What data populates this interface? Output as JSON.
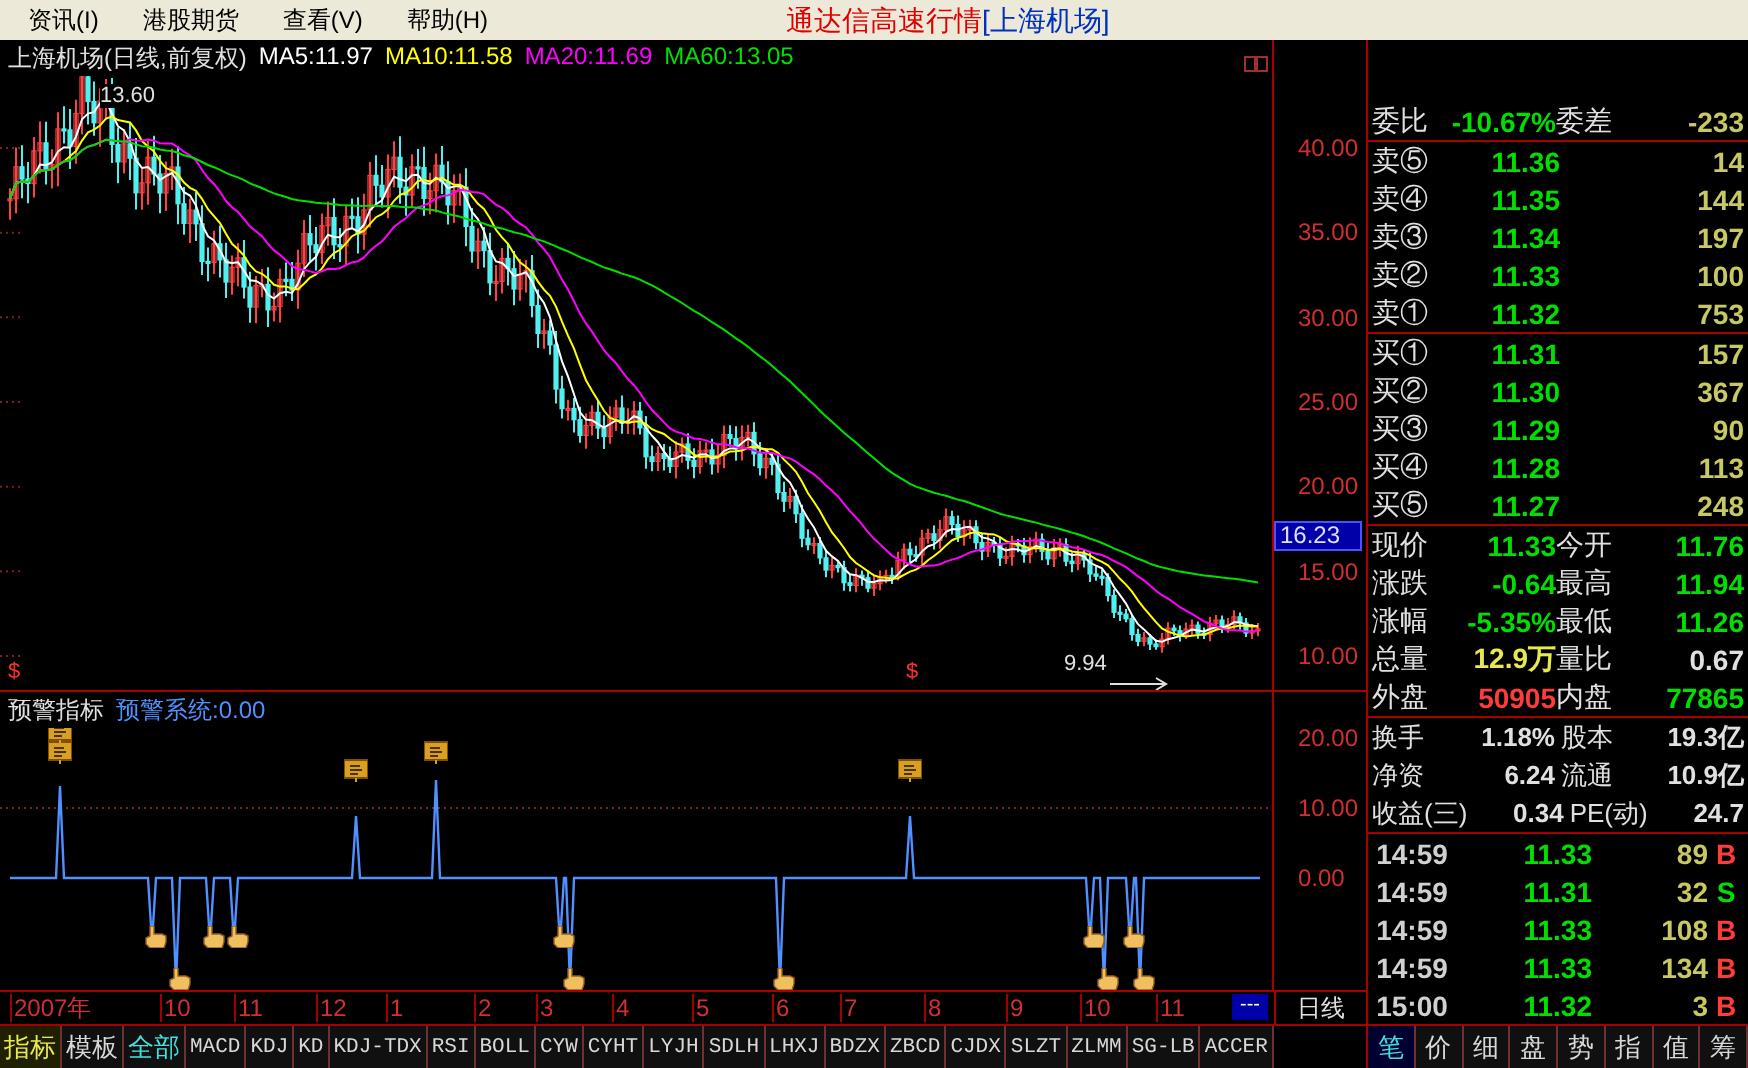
{
  "menu": [
    {
      "label": "资讯(I)"
    },
    {
      "label": "港股期货"
    },
    {
      "label": "查看(V)"
    },
    {
      "label": "帮助(H)"
    }
  ],
  "app_title": {
    "name": "通达信高速行情",
    "security": "[上海机场]"
  },
  "chart": {
    "title": "上海机场(日线,前复权)",
    "ma": [
      {
        "label": "MA5:11.97",
        "color": "#ffffff"
      },
      {
        "label": "MA10:11.58",
        "color": "#ffff00"
      },
      {
        "label": "MA20:11.69",
        "color": "#ff00ff"
      },
      {
        "label": "MA60:13.05",
        "color": "#00e000"
      }
    ],
    "high_label": "13.60",
    "low_label": "9.94",
    "signal_marks": [
      "$",
      "$"
    ],
    "price_ticks": [
      "40.00",
      "35.00",
      "30.00",
      "25.00",
      "20.00",
      "15.00",
      "10.00"
    ],
    "cursor_price": "16.23"
  },
  "indicator": {
    "name": "预警指标",
    "value_label": "预警系统:0.00",
    "ticks": [
      "20.00",
      "10.00",
      "0.00"
    ]
  },
  "date_axis": {
    "labels": [
      "2007年",
      "10",
      "11",
      "12",
      "1",
      "2",
      "3",
      "4",
      "5",
      "6",
      "7",
      "8",
      "9",
      "10",
      "11"
    ],
    "scroll_marker": "---",
    "period": "日线"
  },
  "indicator_tabs": [
    {
      "label": "指标",
      "kind": "label",
      "selected": false
    },
    {
      "label": "模板",
      "kind": "button",
      "selected": false
    },
    {
      "label": "全部",
      "kind": "button",
      "selected": true
    },
    {
      "label": "MACD",
      "kind": "button",
      "selected": false
    },
    {
      "label": "KDJ",
      "kind": "button",
      "selected": false
    },
    {
      "label": "KD",
      "kind": "button",
      "selected": false
    },
    {
      "label": "KDJ-TDX",
      "kind": "button",
      "selected": false
    },
    {
      "label": "RSI",
      "kind": "button",
      "selected": false
    },
    {
      "label": "BOLL",
      "kind": "button",
      "selected": false
    },
    {
      "label": "CYW",
      "kind": "button",
      "selected": false
    },
    {
      "label": "CYHT",
      "kind": "button",
      "selected": false
    },
    {
      "label": "LYJH",
      "kind": "button",
      "selected": false
    },
    {
      "label": "SDLH",
      "kind": "button",
      "selected": false
    },
    {
      "label": "LHXJ",
      "kind": "button",
      "selected": false
    },
    {
      "label": "BDZX",
      "kind": "button",
      "selected": false
    },
    {
      "label": "ZBCD",
      "kind": "button",
      "selected": false
    },
    {
      "label": "CJDX",
      "kind": "button",
      "selected": false
    },
    {
      "label": "SLZT",
      "kind": "button",
      "selected": false
    },
    {
      "label": "ZLMM",
      "kind": "button",
      "selected": false
    },
    {
      "label": "SG-LB",
      "kind": "button",
      "selected": false
    },
    {
      "label": "ACCER",
      "kind": "button",
      "selected": false
    }
  ],
  "quote": {
    "ratio": [
      {
        "label": "委比",
        "value": "-10.67%",
        "color": "#00e000"
      },
      {
        "label": "委差",
        "value": "-233",
        "color": "#c8c864"
      }
    ],
    "asks": [
      {
        "label": "卖⑤",
        "price": "11.36",
        "volume": "14"
      },
      {
        "label": "卖④",
        "price": "11.35",
        "volume": "144"
      },
      {
        "label": "卖③",
        "price": "11.34",
        "volume": "197"
      },
      {
        "label": "卖②",
        "price": "11.33",
        "volume": "100"
      },
      {
        "label": "卖①",
        "price": "11.32",
        "volume": "753"
      }
    ],
    "bids": [
      {
        "label": "买①",
        "price": "11.31",
        "volume": "157"
      },
      {
        "label": "买②",
        "price": "11.30",
        "volume": "367"
      },
      {
        "label": "买③",
        "price": "11.29",
        "volume": "90"
      },
      {
        "label": "买④",
        "price": "11.28",
        "volume": "113"
      },
      {
        "label": "买⑤",
        "price": "11.27",
        "volume": "248"
      }
    ],
    "stats": [
      {
        "label": "现价",
        "value": "11.33",
        "color": "#00e000"
      },
      {
        "label": "今开",
        "value": "11.76",
        "color": "#00e000"
      },
      {
        "label": "涨跌",
        "value": "-0.64",
        "color": "#00e000"
      },
      {
        "label": "最高",
        "value": "11.94",
        "color": "#00e000"
      },
      {
        "label": "涨幅",
        "value": "-5.35%",
        "color": "#00e000"
      },
      {
        "label": "最低",
        "value": "11.26",
        "color": "#00e000"
      },
      {
        "label": "总量",
        "value": "12.9万",
        "color": "#e8e850"
      },
      {
        "label": "量比",
        "value": "0.67",
        "color": "#e0e0e0"
      },
      {
        "label": "外盘",
        "value": "50905",
        "color": "#ff3c3c"
      },
      {
        "label": "内盘",
        "value": "77865",
        "color": "#00e000"
      }
    ],
    "fundamentals": [
      {
        "label": "换手",
        "value": "1.18%"
      },
      {
        "label": "股本",
        "value": "19.3亿"
      },
      {
        "label": "净资",
        "value": "6.24"
      },
      {
        "label": "流通",
        "value": "10.9亿"
      },
      {
        "label": "收益(三)",
        "value": "0.34"
      },
      {
        "label": "PE(动)",
        "value": "24.7"
      }
    ],
    "ticks": [
      {
        "time": "14:59",
        "price": "11.33",
        "volume": "89",
        "side": "B",
        "color": "#ff3c3c"
      },
      {
        "time": "14:59",
        "price": "11.31",
        "volume": "32",
        "side": "S",
        "color": "#00e000"
      },
      {
        "time": "14:59",
        "price": "11.33",
        "volume": "108",
        "side": "B",
        "color": "#ff3c3c"
      },
      {
        "time": "14:59",
        "price": "11.33",
        "volume": "134",
        "side": "B",
        "color": "#ff3c3c"
      },
      {
        "time": "15:00",
        "price": "11.32",
        "volume": "3",
        "side": "B",
        "color": "#ff3c3c"
      }
    ]
  },
  "detail_tabs": [
    {
      "label": "笔",
      "selected": true
    },
    {
      "label": "价",
      "selected": false
    },
    {
      "label": "细",
      "selected": false
    },
    {
      "label": "盘",
      "selected": false
    },
    {
      "label": "势",
      "selected": false
    },
    {
      "label": "指",
      "selected": false
    },
    {
      "label": "值",
      "selected": false
    },
    {
      "label": "筹",
      "selected": false
    }
  ]
}
